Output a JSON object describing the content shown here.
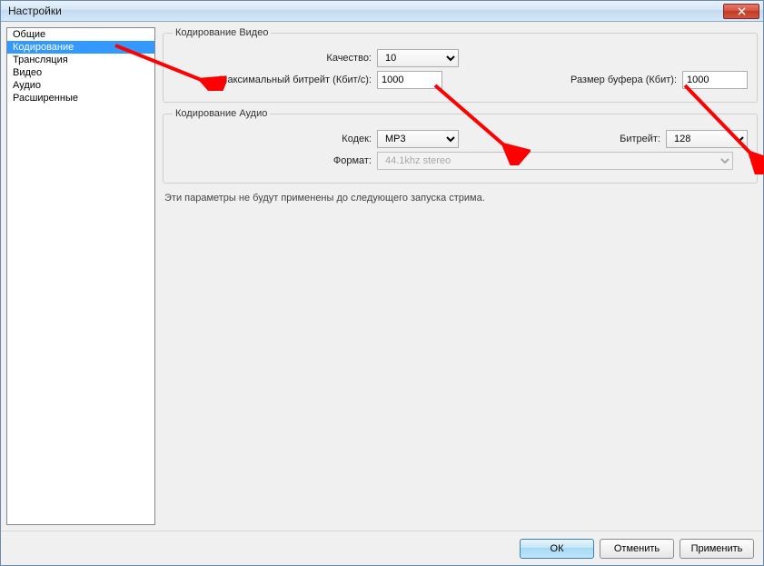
{
  "window": {
    "title": "Настройки"
  },
  "sidebar": {
    "items": [
      {
        "label": "Общие"
      },
      {
        "label": "Кодирование",
        "selected": true
      },
      {
        "label": "Трансляция"
      },
      {
        "label": "Видео"
      },
      {
        "label": "Аудио"
      },
      {
        "label": "Расширенные"
      }
    ]
  },
  "video": {
    "legend": "Кодирование Видео",
    "quality_label": "Качество:",
    "quality_value": "10",
    "max_bitrate_label": "Максимальный битрейт (Кбит/с):",
    "max_bitrate_value": "1000",
    "buffer_size_label": "Размер буфера (Кбит):",
    "buffer_size_value": "1000"
  },
  "audio": {
    "legend": "Кодирование Аудио",
    "codec_label": "Кодек:",
    "codec_value": "MP3",
    "bitrate_label": "Битрейт:",
    "bitrate_value": "128",
    "format_label": "Формат:",
    "format_value": "44.1khz stereo"
  },
  "note": "Эти параметры не будут применены до следующего запуска стрима.",
  "buttons": {
    "ok": "ОК",
    "cancel": "Отменить",
    "apply": "Применить"
  }
}
